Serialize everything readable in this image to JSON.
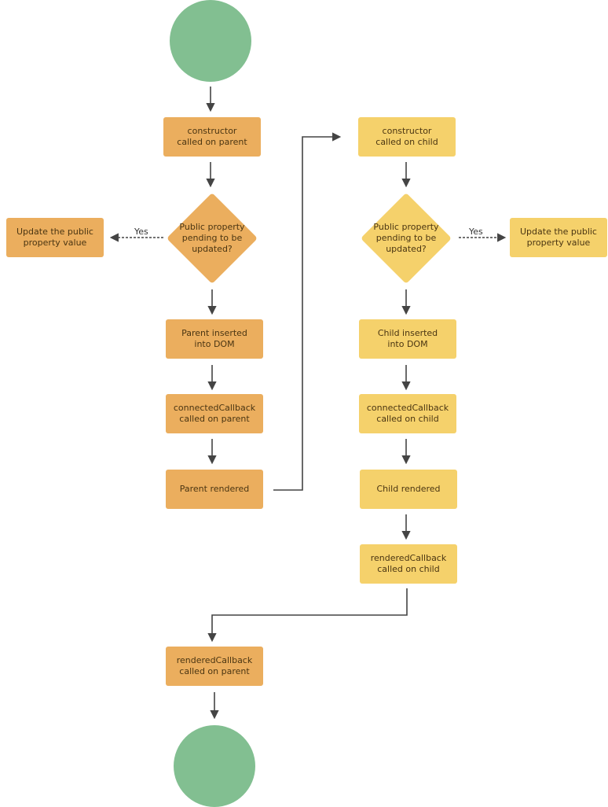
{
  "diagram": {
    "colors": {
      "terminal": "#82bf91",
      "parent": "#ebae5e",
      "child": "#f5d16b",
      "edge": "#444444"
    },
    "nodes": {
      "start": {
        "type": "terminal",
        "label": ""
      },
      "p_constructor": {
        "label": "constructor\ncalled on parent"
      },
      "p_decision": {
        "label": "Public property\npending to be\nupdated?"
      },
      "p_update": {
        "label": "Update the public\nproperty value"
      },
      "p_inserted": {
        "label": "Parent inserted\ninto DOM"
      },
      "p_connected": {
        "label": "connectedCallback\ncalled on parent"
      },
      "p_rendered": {
        "label": "Parent rendered"
      },
      "c_constructor": {
        "label": "constructor\ncalled on child"
      },
      "c_decision": {
        "label": "Public property\npending to be\nupdated?"
      },
      "c_update": {
        "label": "Update the public\nproperty value"
      },
      "c_inserted": {
        "label": "Child inserted\ninto DOM"
      },
      "c_connected": {
        "label": "connectedCallback\ncalled on child"
      },
      "c_rendered": {
        "label": "Child rendered"
      },
      "c_renderedcb": {
        "label": "renderedCallback\ncalled on child"
      },
      "p_renderedcb": {
        "label": "renderedCallback\ncalled on parent"
      },
      "end": {
        "type": "terminal",
        "label": ""
      }
    },
    "edges": [
      {
        "from": "start",
        "to": "p_constructor"
      },
      {
        "from": "p_constructor",
        "to": "p_decision"
      },
      {
        "from": "p_decision",
        "to": "p_update",
        "label": "Yes",
        "style": "dashed"
      },
      {
        "from": "p_decision",
        "to": "p_inserted"
      },
      {
        "from": "p_inserted",
        "to": "p_connected"
      },
      {
        "from": "p_connected",
        "to": "p_rendered"
      },
      {
        "from": "p_rendered",
        "to": "c_constructor"
      },
      {
        "from": "c_constructor",
        "to": "c_decision"
      },
      {
        "from": "c_decision",
        "to": "c_update",
        "label": "Yes",
        "style": "dashed"
      },
      {
        "from": "c_decision",
        "to": "c_inserted"
      },
      {
        "from": "c_inserted",
        "to": "c_connected"
      },
      {
        "from": "c_connected",
        "to": "c_rendered"
      },
      {
        "from": "c_rendered",
        "to": "c_renderedcb"
      },
      {
        "from": "c_renderedcb",
        "to": "p_renderedcb"
      },
      {
        "from": "p_renderedcb",
        "to": "end"
      }
    ],
    "yes_label": "Yes"
  }
}
